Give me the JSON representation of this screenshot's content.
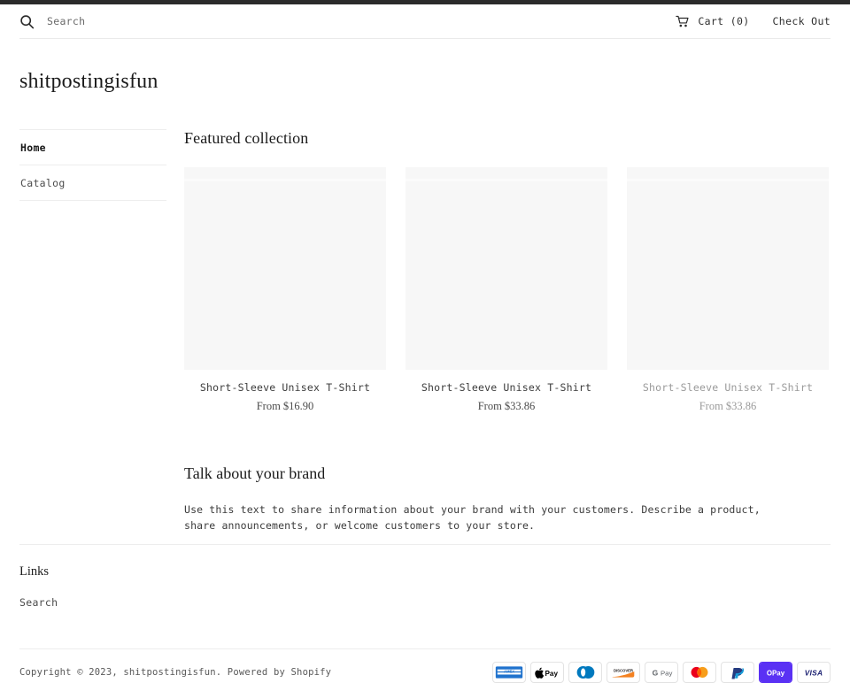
{
  "header": {
    "search_icon": "search-icon",
    "search_placeholder": "Search",
    "search_value": "",
    "cart_icon": "shopping-cart-icon",
    "cart_label": "Cart (0)",
    "checkout_label": "Check Out"
  },
  "store": {
    "title": "shitpostingisfun"
  },
  "sidebar": {
    "items": [
      {
        "label": "Home",
        "active": true
      },
      {
        "label": "Catalog",
        "active": false
      }
    ]
  },
  "main": {
    "featured_title": "Featured collection",
    "products": [
      {
        "name": "Short-Sleeve Unisex T-Shirt",
        "price": "From $16.90",
        "muted": false
      },
      {
        "name": "Short-Sleeve Unisex T-Shirt",
        "price": "From $33.86",
        "muted": false
      },
      {
        "name": "Short-Sleeve Unisex T-Shirt",
        "price": "From $33.86",
        "muted": true
      }
    ],
    "brand_title": "Talk about your brand",
    "brand_body": "Use this text to share information about your brand with your customers. Describe a product, share announcements, or welcome customers to your store."
  },
  "footer": {
    "links_heading": "Links",
    "links": [
      {
        "label": "Search"
      }
    ],
    "copyright_prefix": "Copyright © 2023, ",
    "copyright_store": "shitpostingisfun",
    "copyright_suffix": ". Powered by ",
    "copyright_platform": "Shopify",
    "payment_methods": [
      {
        "name": "american-express",
        "label": "AMEX"
      },
      {
        "name": "apple-pay",
        "label": "Apple Pay"
      },
      {
        "name": "diners-club",
        "label": "Diners Club"
      },
      {
        "name": "discover",
        "label": "DISCOVER"
      },
      {
        "name": "google-pay",
        "label": "G Pay"
      },
      {
        "name": "mastercard",
        "label": "Mastercard"
      },
      {
        "name": "paypal",
        "label": "PayPal"
      },
      {
        "name": "shop-pay",
        "label": "Shop Pay"
      },
      {
        "name": "visa",
        "label": "VISA"
      }
    ]
  },
  "colors": {
    "text": "#2f2f2f",
    "muted": "#9a9a9a",
    "rule": "#ededed",
    "placeholder_bg": "#f7f7f7",
    "shop_pay_purple": "#5a31f4",
    "amex_blue": "#1F72CD",
    "visa_navy": "#1A1F71",
    "paypal_blue": "#253B80",
    "mastercard_red": "#EB001B",
    "mastercard_orange": "#F79E1B",
    "discover_orange": "#F48120",
    "diners_blue": "#0079BE"
  }
}
